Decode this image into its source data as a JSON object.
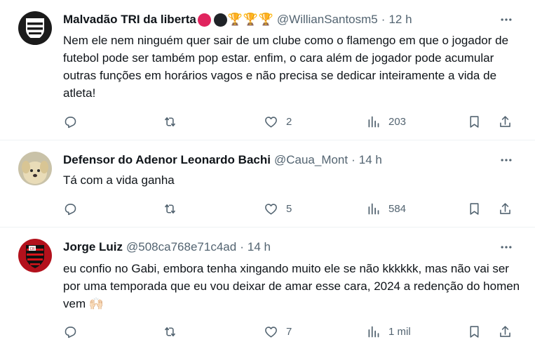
{
  "tweets": [
    {
      "name": "Malvadão TRI da liberta",
      "badges": {
        "circle_colors": [
          "#e0245e",
          "#1f2328"
        ],
        "trophy": "🏆"
      },
      "handle": "@WillianSantosm5",
      "dot": "·",
      "time": "12 h",
      "text": "Nem ele nem ninguém quer sair de um clube como o flamengo em que o jogador de futebol pode ser também pop estar. enfim, o cara além de jogador pode acumular outras funções em horários vagos e não precisa se dedicar inteiramente a vida de atleta!",
      "likes": "2",
      "views": "203",
      "avatar": "team-crest-icon"
    },
    {
      "name": "Defensor do Adenor Leonardo Bachi",
      "handle": "@Caua_Mont",
      "dot": "·",
      "time": "14 h",
      "text": "Tá com a vida ganha",
      "likes": "5",
      "views": "584",
      "avatar": "dog-photo-icon"
    },
    {
      "name": "Jorge Luiz",
      "handle": "@508ca768e71c4ad",
      "dot": "·",
      "time": "14 h",
      "text": "eu confio no Gabi, embora tenha xingando muito ele se não kkkkkk, mas não vai ser por uma temporada que eu vou deixar de amar esse cara, 2024 a redenção do homen vem 🙌🏻",
      "likes": "7",
      "views": "1 mil",
      "avatar": "flamengo-crest-icon"
    }
  ],
  "colors": {
    "muted": "#536471",
    "text": "#0f1419",
    "divider": "#eff3f4"
  }
}
